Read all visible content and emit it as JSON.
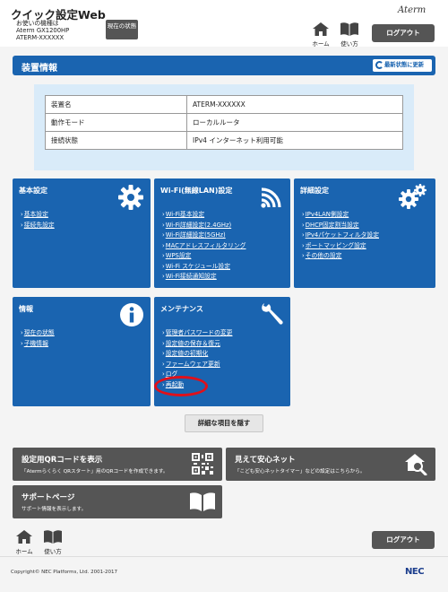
{
  "header": {
    "app_title": "クイック設定Web",
    "model_label": "お使いの機種は",
    "model_name": "Aterm GX1200HP",
    "device_name": "ATERM-XXXXXX",
    "status_button": "現在の状態",
    "brand": "Aterm",
    "home_label": "ホーム",
    "help_label": "使い方",
    "logout_label": "ログアウト"
  },
  "device_info": {
    "title": "装置情報",
    "refresh_label": "最新状態に更新",
    "rows": [
      {
        "key": "装置名",
        "value": "ATERM-XXXXXX"
      },
      {
        "key": "動作モード",
        "value": "ローカルルータ"
      },
      {
        "key": "接続状態",
        "value": "IPv4 インターネット利用可能"
      }
    ]
  },
  "cards": {
    "basic": {
      "title": "基本設定",
      "icon": "gear-icon",
      "links": [
        "基本設定",
        "接続先設定"
      ]
    },
    "wifi": {
      "title": "Wi-Fi(無線LAN)設定",
      "icon": "wifi-icon",
      "links": [
        "Wi-Fi基本設定",
        "Wi-Fi詳細設定(2.4GHz)",
        "Wi-Fi詳細設定(5GHz)",
        "MACアドレスフィルタリング",
        "WPS設定",
        "Wi-Fi スケジュール設定",
        "Wi-Fi接続通知設定"
      ]
    },
    "advanced": {
      "title": "詳細設定",
      "icon": "gears-icon",
      "links": [
        "IPv4LAN側設定",
        "DHCP固定割当設定",
        "IPv4パケットフィルタ設定",
        "ポートマッピング設定",
        "その他の設定"
      ]
    },
    "info": {
      "title": "情報",
      "icon": "info-icon",
      "links": [
        "現在の状態",
        "子機情報"
      ]
    },
    "maintenance": {
      "title": "メンテナンス",
      "icon": "wrench-icon",
      "links": [
        "管理者パスワードの変更",
        "設定値の保存＆復元",
        "設定値の初期化",
        "ファームウェア更新",
        "ログ",
        "再起動"
      ]
    }
  },
  "hide_button": "詳細な項目を隠す",
  "promos": {
    "qr": {
      "title": "設定用QRコードを表示",
      "desc": "「Atermらくらく QRスタート」用のQRコードを作成できます。",
      "icon": "qr-code-icon"
    },
    "safe": {
      "title": "見えて安心ネット",
      "desc": "「こども安心ネットタイマー」などの設定はこちらから。",
      "icon": "house-search-icon"
    },
    "support": {
      "title": "サポートページ",
      "desc": "サポート情報を表示します。",
      "icon": "book-icon"
    }
  },
  "footer": {
    "home_label": "ホーム",
    "help_label": "使い方",
    "logout_label": "ログアウト",
    "copyright": "Copyright© NEC Platforms, Ltd. 2001-2017",
    "company_logo": "NEC"
  },
  "colors": {
    "primary": "#1a64b0",
    "dark": "#555555",
    "highlight_ring": "#e0101a",
    "panel": "#d9ebf9"
  }
}
